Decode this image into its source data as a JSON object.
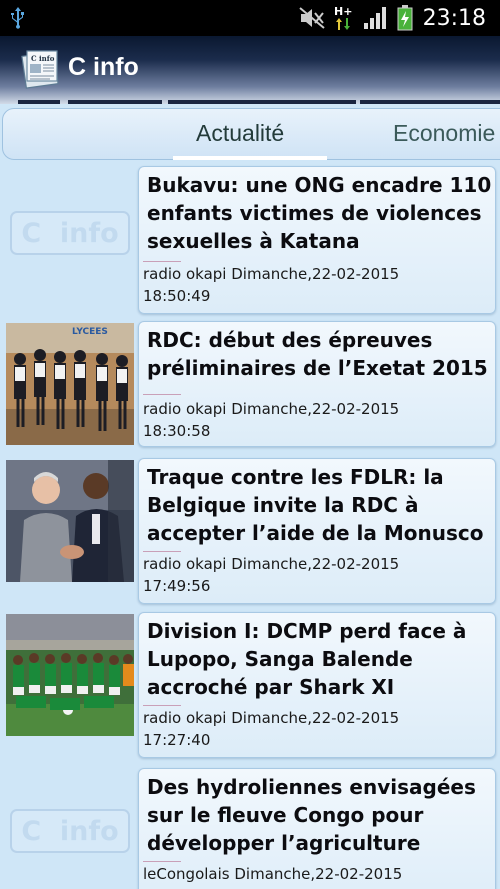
{
  "status_bar": {
    "time": "23:18",
    "network": "H+",
    "icons": [
      "usb-icon",
      "mute-icon",
      "network-data-icon",
      "signal-icon",
      "battery-charging-icon"
    ]
  },
  "app": {
    "title": "C info",
    "logo_text": "C info"
  },
  "tabs": [
    {
      "label": "Actualité",
      "active": true
    },
    {
      "label": "Economie",
      "active": false
    }
  ],
  "placeholder": {
    "letter": "C",
    "word": "info"
  },
  "news": [
    {
      "title": "Bukavu: une ONG encadre 110 enfants victimes de violences sexuelles à Katana",
      "source_date": "radio okapi Dimanche,22-02-2015",
      "time": "18:50:49",
      "thumbnail": "placeholder"
    },
    {
      "title": "RDC: début des épreuves préliminaires de l’Exetat 2015",
      "source_date": "radio okapi Dimanche,22-02-2015",
      "time": "18:30:58",
      "thumbnail": "students-photo",
      "photo_text": "LYCEES"
    },
    {
      "title": "Traque contre les FDLR: la Belgique invite la RDC à accepter l’aide de la Monusco",
      "source_date": "radio okapi Dimanche,22-02-2015",
      "time": "17:49:56",
      "thumbnail": "handshake-photo"
    },
    {
      "title": "Division I: DCMP perd face à Lupopo, Sanga Balende accroché par Shark XI",
      "source_date": "radio okapi Dimanche,22-02-2015",
      "time": "17:27:40",
      "thumbnail": "football-team-photo"
    },
    {
      "title": "Des hydroliennes envisagées sur le fleuve Congo pour développer l’agriculture",
      "source_date": "leCongolais Dimanche,22-02-2015",
      "time": "",
      "thumbnail": "placeholder"
    }
  ],
  "colors": {
    "background": "#cfe6f7",
    "card": "#e6f1fa",
    "action_bar": "#1b2c4c",
    "text": "#0c0c10"
  }
}
